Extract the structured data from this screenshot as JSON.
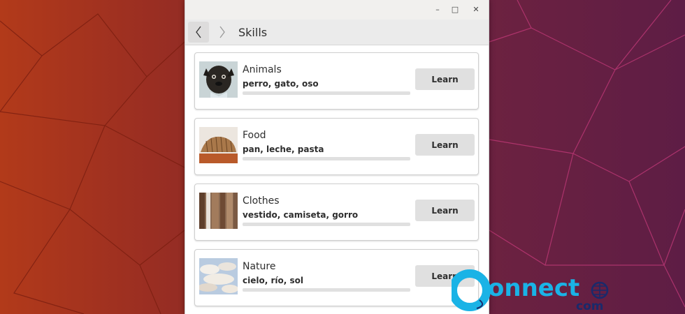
{
  "window": {
    "controls": {
      "minimize": "–",
      "maximize": "□",
      "close": "✕"
    },
    "title": "Skills"
  },
  "navigation": {
    "back_icon": "chevron-left-icon",
    "forward_icon": "chevron-right-icon"
  },
  "skills": [
    {
      "category": "Animals",
      "words": "perro, gato, oso",
      "button": "Learn",
      "progress": 0,
      "image": "pug-photo"
    },
    {
      "category": "Food",
      "words": "pan, leche, pasta",
      "button": "Learn",
      "progress": 0,
      "image": "bread-photo"
    },
    {
      "category": "Clothes",
      "words": "vestido, camiseta, gorro",
      "button": "Learn",
      "progress": 0,
      "image": "fabric-photo"
    },
    {
      "category": "Nature",
      "words": "cielo, río, sol",
      "button": "Learn",
      "progress": 0,
      "image": "sky-photo"
    }
  ],
  "watermark": {
    "brand": "onnect",
    "suffix": "com"
  },
  "colors": {
    "accent": "#1ab3e6",
    "button_bg": "#e0e0e0",
    "progress_track": "#e0e0e0"
  }
}
